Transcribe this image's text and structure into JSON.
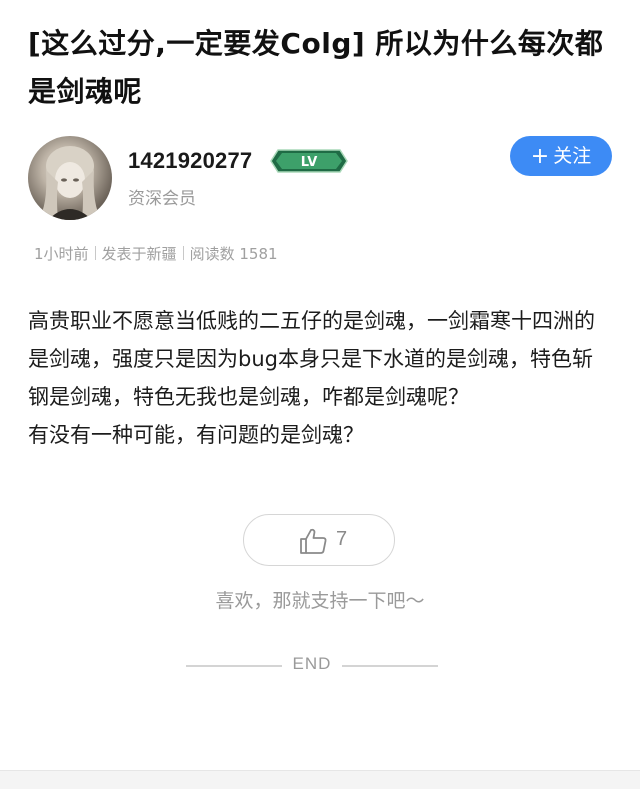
{
  "post": {
    "title": "[这么过分,一定要发Colg] 所以为什么每次都是剑魂呢"
  },
  "author": {
    "username": "1421920277",
    "level_badge": "LV",
    "member_level": "资深会员",
    "follow_label": "关注",
    "follow_icon": "plus-icon"
  },
  "meta": {
    "time": "1小时前",
    "location": "发表于新疆",
    "views_label": "阅读数",
    "views": "1581"
  },
  "content": {
    "paragraphs": [
      "高贵职业不愿意当低贱的二五仔的是剑魂，一剑霜寒十四洲的是剑魂，强度只是因为bug本身只是下水道的是剑魂，特色斩钢是剑魂，特色无我也是剑魂，咋都是剑魂呢？",
      "有没有一种可能，有问题的是剑魂？"
    ]
  },
  "like": {
    "icon": "thumbs-up-icon",
    "count": "7",
    "hint": "喜欢，那就支持一下吧～"
  },
  "footer": {
    "end_label": "END"
  },
  "colors": {
    "accent": "#3d8bf5",
    "badge_green": "#2e8b57",
    "text_primary": "#1c1c1c",
    "text_muted": "#9a9a9a"
  }
}
